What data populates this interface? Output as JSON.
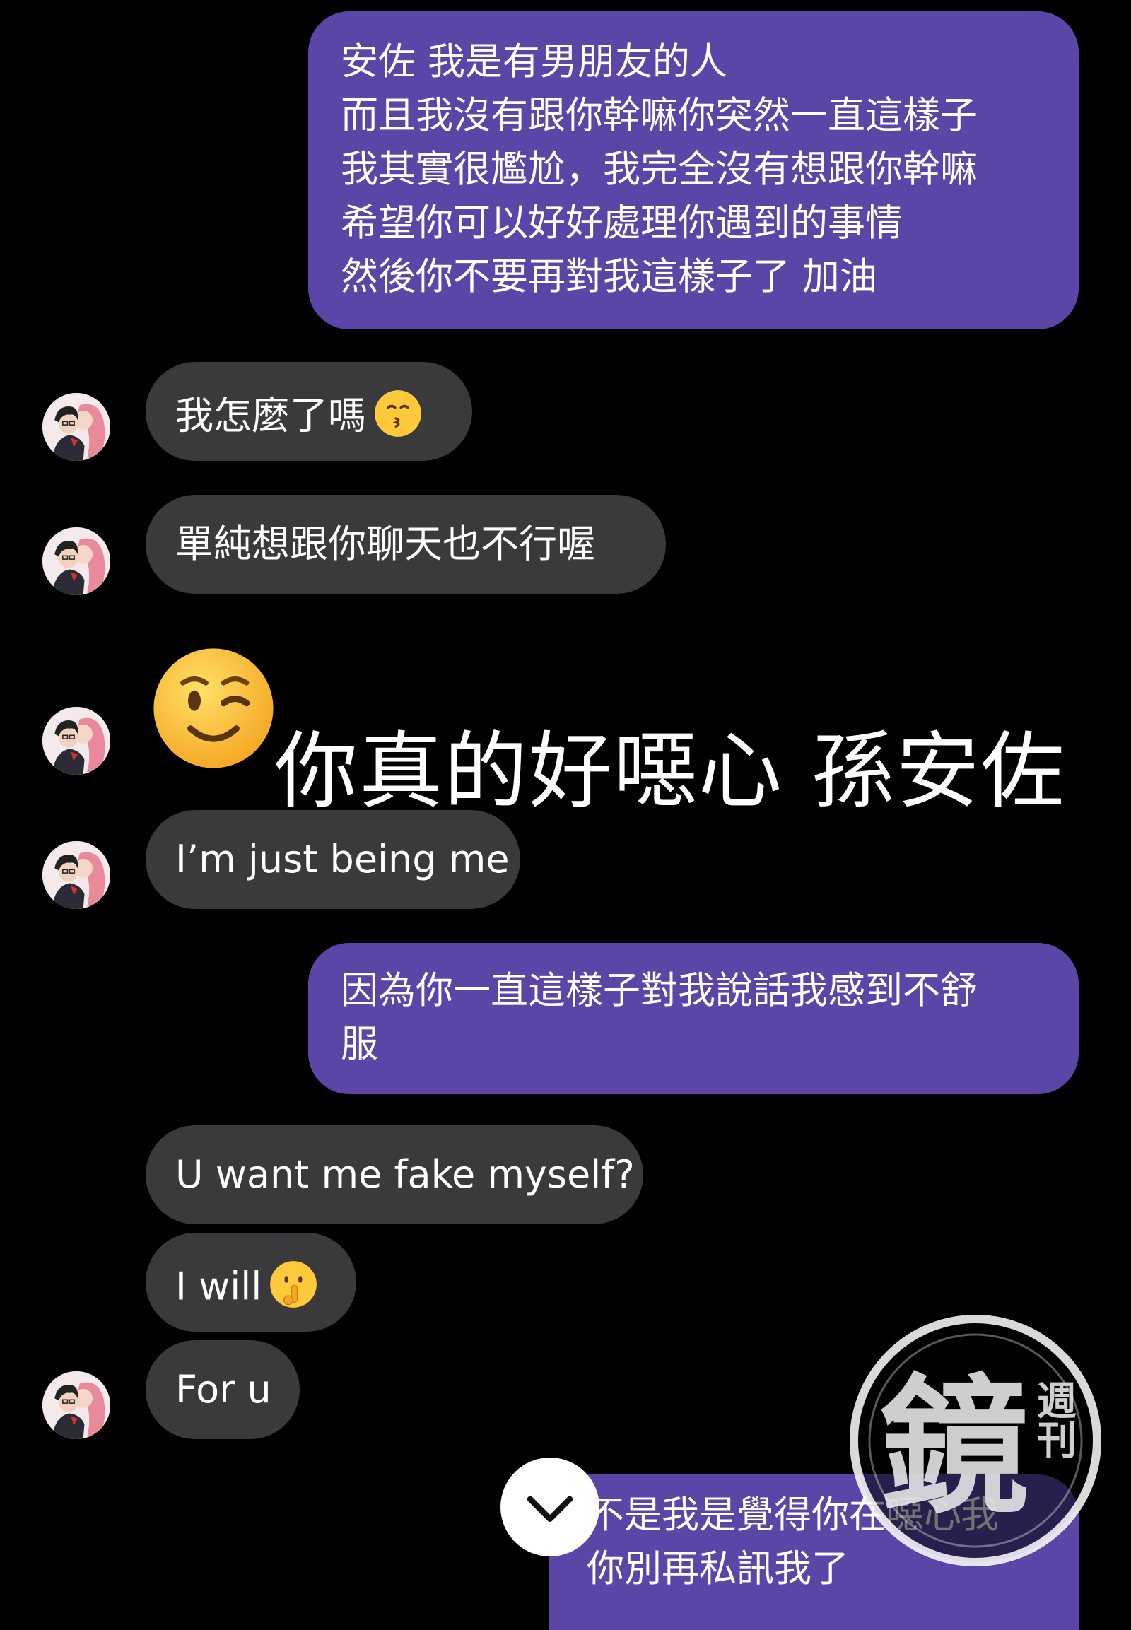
{
  "messages": {
    "m1": {
      "lines": [
        "安佐 我是有男朋友的人",
        "而且我沒有跟你幹嘛你突然一直這樣子",
        "我其實很尷尬，我完全沒有想跟你幹嘛",
        "希望你可以好好處理你遇到的事情",
        "然後你不要再對我這樣子了 加油"
      ]
    },
    "m2": {
      "text": "我怎麼了嗎",
      "emoji": "kissing-face"
    },
    "m3": {
      "text": "單純想跟你聊天也不行喔"
    },
    "m4": {
      "emoji": "winking-face"
    },
    "m5": {
      "text": "I’m just being me"
    },
    "m6": {
      "lines": [
        "因為你一直這樣子對我說話我感到不舒",
        "服"
      ]
    },
    "m7": {
      "text": "U want me fake myself?"
    },
    "m8": {
      "text": "I will",
      "emoji": "shushing-face"
    },
    "m9": {
      "text": "For u"
    },
    "m10": {
      "lines": [
        "不是我是覺得你在噁心我",
        "你別再私訊我了"
      ]
    }
  },
  "caption": {
    "text": "你真的好噁心 孫安佐"
  },
  "watermark": {
    "brand": "鏡",
    "sub": "週刊"
  },
  "scroll_button": {
    "icon": "chevron-down-icon"
  },
  "colors": {
    "background": "#000000",
    "incoming_bubble": "#3a3a3c",
    "outgoing_bubble": "#5b46a8",
    "text": "#ffffff",
    "emoji": "#ffc93c"
  }
}
